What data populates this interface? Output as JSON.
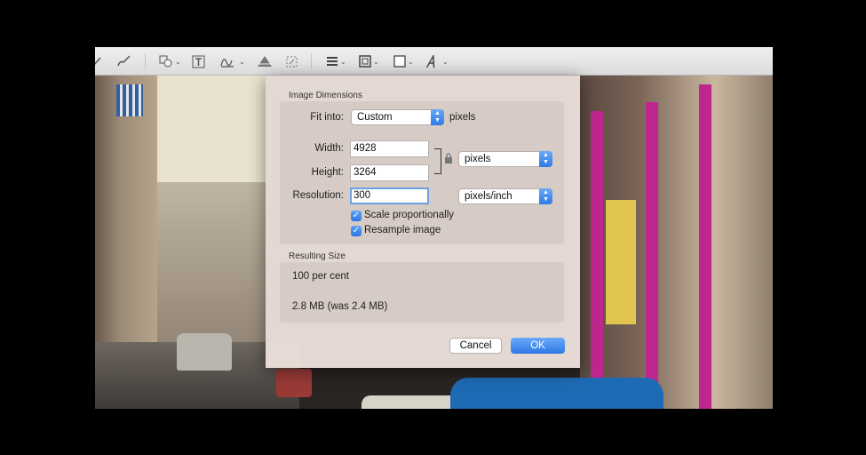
{
  "toolbar": {
    "icons": [
      "select-icon",
      "sketch-icon",
      "shapes-icon",
      "text-icon",
      "sign-icon",
      "adjust-color-icon",
      "adjust-size-icon",
      "shape-style-icon",
      "border-color-icon",
      "fill-color-icon",
      "text-style-icon"
    ]
  },
  "dialog": {
    "image_dimensions": {
      "title": "Image Dimensions",
      "fit_into_label": "Fit into:",
      "fit_into_value": "Custom",
      "fit_into_unit": "pixels",
      "width_label": "Width:",
      "width_value": "4928",
      "height_label": "Height:",
      "height_value": "3264",
      "size_unit": "pixels",
      "resolution_label": "Resolution:",
      "resolution_value": "300",
      "resolution_unit": "pixels/inch",
      "scale_proportionally_label": "Scale proportionally",
      "scale_proportionally_checked": true,
      "resample_label": "Resample image",
      "resample_checked": true
    },
    "resulting_size": {
      "title": "Resulting Size",
      "percent": "100 per cent",
      "file_size": "2.8 MB (was 2.4 MB)"
    },
    "buttons": {
      "cancel": "Cancel",
      "ok": "OK"
    }
  },
  "colors": {
    "accent": "#2d78e6",
    "focus_ring": "#6e9fe0"
  }
}
